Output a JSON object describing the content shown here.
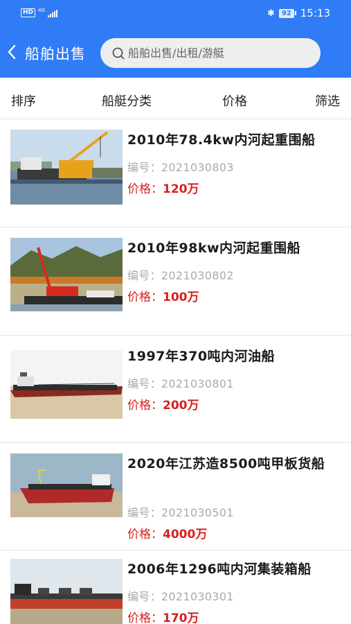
{
  "status_bar": {
    "badge": "HD",
    "network": "4G",
    "battery": "92",
    "time": "15:13"
  },
  "nav": {
    "back_icon": "chevron-left-icon",
    "title": "船舶出售",
    "search_placeholder": "船舶出售/出租/游艇"
  },
  "filters": [
    {
      "label": "排序"
    },
    {
      "label": "船艇分类"
    },
    {
      "label": "价格"
    },
    {
      "label": "筛选"
    }
  ],
  "code_label": "编号：",
  "price_label": "价格：",
  "listings": [
    {
      "title": "2010年78.4kw内河起重围船",
      "code": "2021030803",
      "price": "120万"
    },
    {
      "title": "2010年98kw内河起重围船",
      "code": "2021030802",
      "price": "100万"
    },
    {
      "title": "1997年370吨内河油船",
      "code": "2021030801",
      "price": "200万"
    },
    {
      "title": "2020年江苏造8500吨甲板货船",
      "code": "2021030501",
      "price": "4000万"
    },
    {
      "title": "2006年1296吨内河集装箱船",
      "code": "2021030301",
      "price": "170万"
    }
  ],
  "colors": {
    "header": "#2f7cf6",
    "price": "#d81e1e",
    "code": "#aaaaaa"
  }
}
